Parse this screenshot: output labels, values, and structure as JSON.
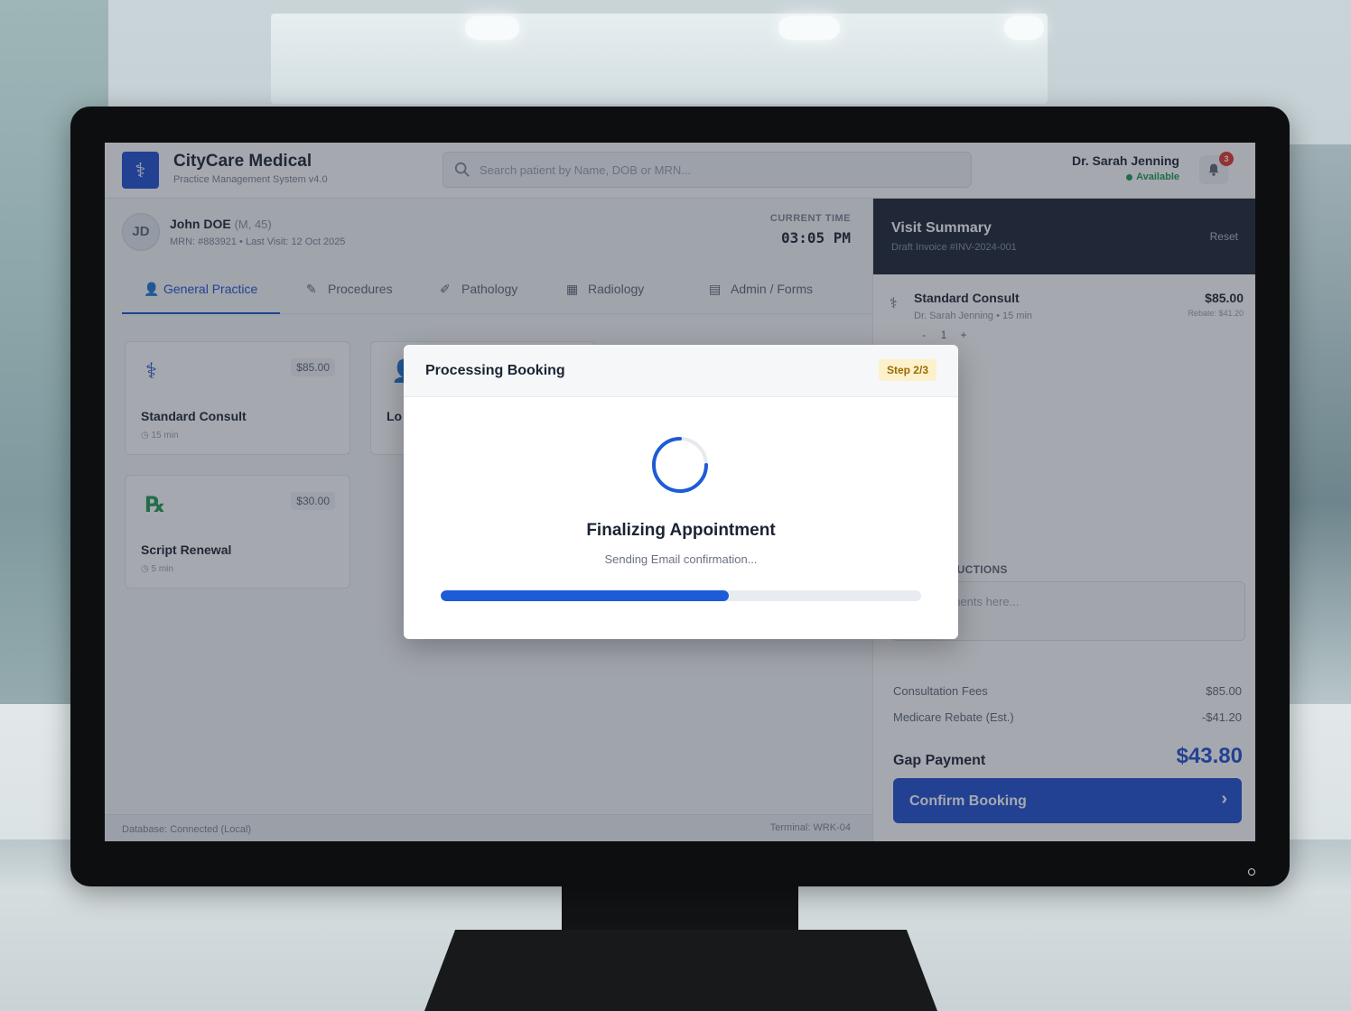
{
  "app": {
    "name": "CityCare Medical",
    "subtitle": "Practice Management System v4.0",
    "logo_glyph": "⚕"
  },
  "search": {
    "placeholder": "Search patient by Name, DOB or MRN..."
  },
  "user": {
    "name": "Dr. Sarah Jenning",
    "status": "Available",
    "notifications": "3"
  },
  "patient": {
    "initials": "JD",
    "name": "John DOE",
    "meta": "(M, 45)",
    "mrn_line": "MRN: #883921 • Last Visit: 12 Oct 2025"
  },
  "clock": {
    "label": "CURRENT TIME",
    "value": "03:05 PM"
  },
  "tabs": [
    {
      "label": "General Practice",
      "icon": "person-icon",
      "active": true
    },
    {
      "label": "Procedures",
      "icon": "pencil-icon",
      "active": false
    },
    {
      "label": "Pathology",
      "icon": "pen-icon",
      "active": false
    },
    {
      "label": "Radiology",
      "icon": "film-icon",
      "active": false
    },
    {
      "label": "Admin / Forms",
      "icon": "document-icon",
      "active": false
    }
  ],
  "services": [
    {
      "title": "Standard Consult",
      "price": "$85.00",
      "duration": "15 min",
      "icon": "stethoscope-icon"
    },
    {
      "title": "Lo",
      "price": "",
      "duration": "",
      "icon": "person-icon"
    },
    {
      "title": "Script Renewal",
      "price": "$30.00",
      "duration": "5 min",
      "icon": "rx-icon"
    }
  ],
  "footer": {
    "db_status": "Database: Connected (Local)",
    "terminal": "Terminal: WRK-04"
  },
  "summary": {
    "title": "Visit Summary",
    "invoice": "Draft Invoice #INV-2024-001",
    "reset_label": "Reset",
    "item": {
      "name": "Standard Consult",
      "detail": "Dr. Sarah Jenning • 15 min",
      "price": "$85.00",
      "rebate": "Rebate: $41.20",
      "qty": "1",
      "minus": "-",
      "plus": "+"
    },
    "notes_label": "TES / INSTRUCTIONS",
    "notes_placeholder": "c requirements here...",
    "fees": [
      {
        "label": "Consultation Fees",
        "value": "$85.00"
      },
      {
        "label": "Medicare Rebate (Est.)",
        "value": "-$41.20"
      }
    ],
    "gap_label": "Gap Payment",
    "gap_value": "$43.80",
    "confirm_label": "Confirm Booking",
    "confirm_arrow": "›"
  },
  "modal": {
    "title": "Processing Booking",
    "step": "Step 2/3",
    "heading": "Finalizing Appointment",
    "message": "Sending Email confirmation...",
    "progress": 0.6
  },
  "colors": {
    "accent": "#1e4fd1",
    "dark_panel": "#1b2335",
    "success": "#1d9a52",
    "badge": "#e0362c",
    "step_badge_bg": "#fdf1cc"
  }
}
